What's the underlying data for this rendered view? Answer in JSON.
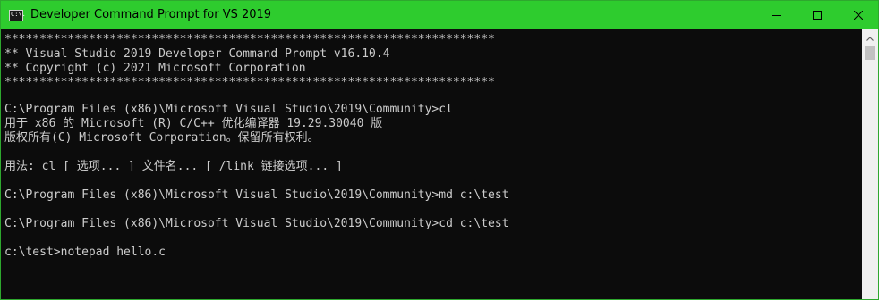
{
  "window": {
    "title": "Developer Command Prompt for VS 2019",
    "app_icon": "cmd-icon",
    "app_icon_glyph": "C:\\."
  },
  "caption_buttons": {
    "minimize_icon": "minimize-icon",
    "maximize_icon": "maximize-icon",
    "close_icon": "close-icon"
  },
  "console": {
    "lines": [
      "**********************************************************************",
      "** Visual Studio 2019 Developer Command Prompt v16.10.4",
      "** Copyright (c) 2021 Microsoft Corporation",
      "**********************************************************************",
      "",
      "C:\\Program Files (x86)\\Microsoft Visual Studio\\2019\\Community>cl",
      "用于 x86 的 Microsoft (R) C/C++ 优化编译器 19.29.30040 版",
      "版权所有(C) Microsoft Corporation。保留所有权利。",
      "",
      "用法: cl [ 选项... ] 文件名... [ /link 链接选项... ]",
      "",
      "C:\\Program Files (x86)\\Microsoft Visual Studio\\2019\\Community>md c:\\test",
      "",
      "C:\\Program Files (x86)\\Microsoft Visual Studio\\2019\\Community>cd c:\\test",
      "",
      "c:\\test>notepad hello.c"
    ]
  },
  "scrollbar": {
    "up_icon": "scroll-up-arrow-icon"
  },
  "colors": {
    "titlebar_bg": "#2ecc2e",
    "console_bg": "#0c0c0c",
    "console_fg": "#cccccc"
  }
}
